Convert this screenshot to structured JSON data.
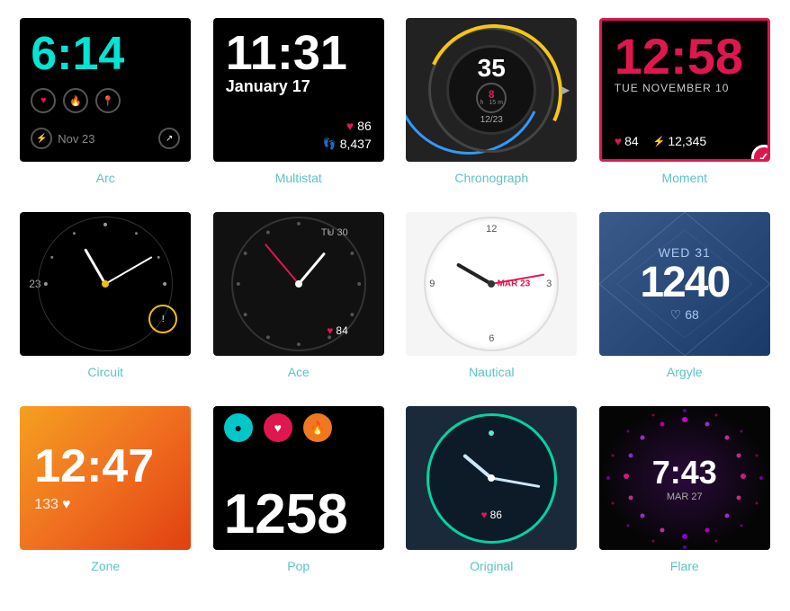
{
  "watches": [
    {
      "id": "arc",
      "name": "Arc",
      "time": "6:14",
      "date": "Nov 23"
    },
    {
      "id": "multistat",
      "name": "Multistat",
      "time": "11:31",
      "date": "January 17",
      "heart": "86",
      "steps": "8,437"
    },
    {
      "id": "chronograph",
      "name": "Chronograph",
      "bigNum": "35",
      "hours": "8",
      "mins": "15",
      "date": "12/23"
    },
    {
      "id": "moment",
      "name": "Moment",
      "time": "12:58",
      "dateDay": "TUE",
      "dateMonth": "NOVEMBER 10",
      "heart": "84",
      "steps": "12,345",
      "selected": true
    },
    {
      "id": "circuit",
      "name": "Circuit",
      "hourNum": "23"
    },
    {
      "id": "ace",
      "name": "Ace",
      "dateLabel": "TU 30",
      "heart": "84"
    },
    {
      "id": "nautical",
      "name": "Nautical",
      "dateLabel": "MAR 23"
    },
    {
      "id": "argyle",
      "name": "Argyle",
      "dayLabel": "WED 31",
      "time": "1240",
      "heart": "68"
    },
    {
      "id": "zone",
      "name": "Zone",
      "time": "12:47",
      "steps": "133"
    },
    {
      "id": "pop",
      "name": "Pop",
      "time": "1258"
    },
    {
      "id": "original",
      "name": "Original",
      "heart": "86"
    },
    {
      "id": "flare",
      "name": "Flare",
      "time": "7:43",
      "date": "MAR 27"
    }
  ]
}
